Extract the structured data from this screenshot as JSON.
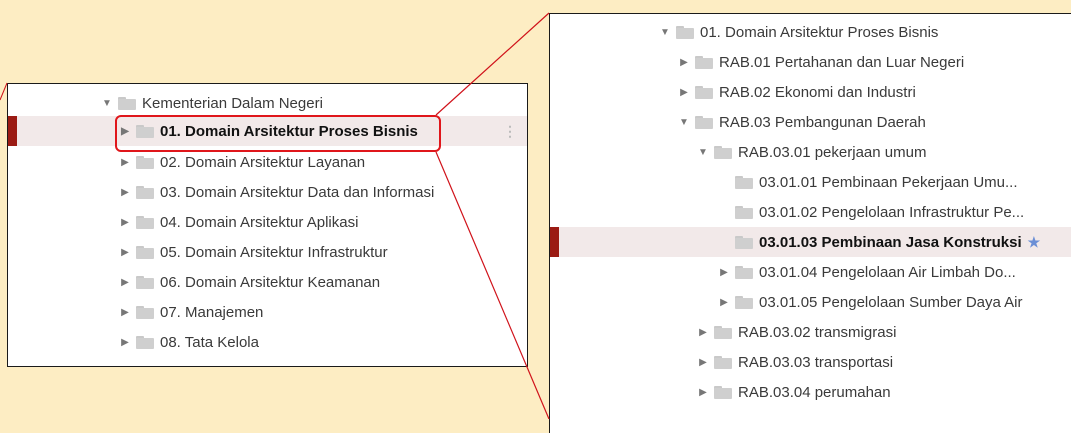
{
  "left_tree": {
    "root": {
      "label": "Kementerian Dalam Negeri",
      "expanded": true
    },
    "items": [
      {
        "label": "01. Domain Arsitektur Proses Bisnis",
        "selected": true
      },
      {
        "label": "02. Domain Arsitektur Layanan"
      },
      {
        "label": "03. Domain Arsitektur Data dan Informasi"
      },
      {
        "label": "04. Domain Arsitektur Aplikasi"
      },
      {
        "label": "05. Domain Arsitektur Infrastruktur"
      },
      {
        "label": "06. Domain Arsitektur Keamanan"
      },
      {
        "label": "07. Manajemen"
      },
      {
        "label": "08. Tata Kelola"
      }
    ]
  },
  "right_tree": {
    "root": {
      "label": "01. Domain Arsitektur Proses Bisnis"
    },
    "items": [
      {
        "label": "RAB.01 Pertahanan dan Luar Negeri"
      },
      {
        "label": "RAB.02 Ekonomi dan Industri"
      },
      {
        "label": "RAB.03 Pembangunan Daerah"
      },
      {
        "label": "RAB.03.01 pekerjaan umum"
      },
      {
        "label": "03.01.01 Pembinaan Pekerjaan Umu..."
      },
      {
        "label": "03.01.02 Pengelolaan Infrastruktur Pe..."
      },
      {
        "label": "03.01.03 Pembinaan Jasa Konstruksi",
        "selected": true
      },
      {
        "label": "03.01.04 Pengelolaan Air Limbah Do..."
      },
      {
        "label": "03.01.05 Pengelolaan Sumber Daya Air"
      },
      {
        "label": "RAB.03.02 transmigrasi"
      },
      {
        "label": "RAB.03.03 transportasi"
      },
      {
        "label": "RAB.03.04 perumahan"
      }
    ]
  },
  "colors": {
    "background": "#fdedc3",
    "selection_bar": "#9b1b14",
    "highlight": "#e0161b",
    "callout_line": "#d0121a"
  },
  "icons": {
    "expanded": "triangle-down-icon",
    "collapsed": "triangle-right-icon",
    "folder": "folder-icon",
    "more": "more-vertical-icon",
    "pin": "pin-icon"
  }
}
